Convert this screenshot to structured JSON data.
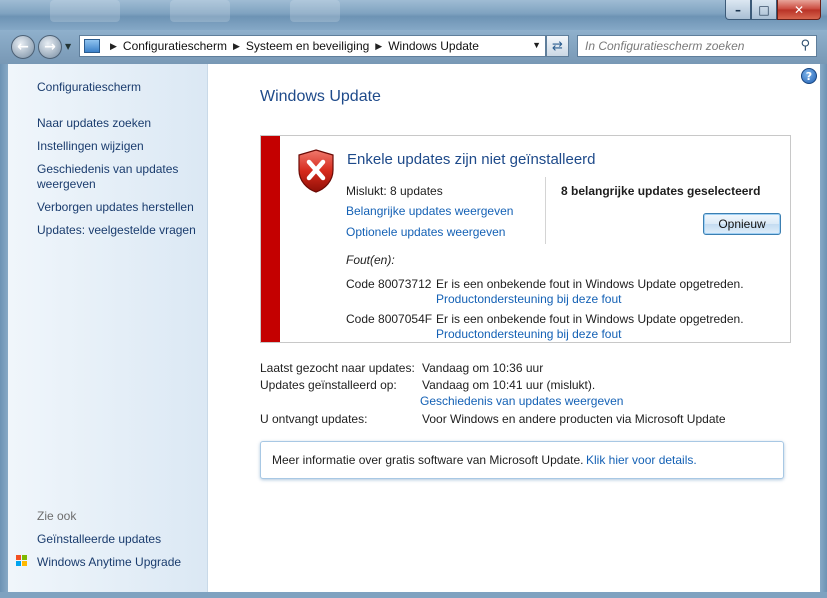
{
  "window": {
    "caption_buttons": {
      "minimize": "–",
      "maximize": "□",
      "close": "✕"
    }
  },
  "navbar": {
    "breadcrumbs": [
      "Configuratiescherm",
      "Systeem en beveiliging",
      "Windows Update"
    ],
    "search_placeholder": "In Configuratiescherm zoeken"
  },
  "sidebar": {
    "home": "Configuratiescherm",
    "links": [
      "Naar updates zoeken",
      "Instellingen wijzigen",
      "Geschiedenis van updates weergeven",
      "Verborgen updates herstellen",
      "Updates: veelgestelde vragen"
    ],
    "see_also_header": "Zie ook",
    "see_also": [
      "Geïnstalleerde updates",
      "Windows Anytime Upgrade"
    ]
  },
  "main": {
    "title": "Windows Update",
    "error_panel": {
      "heading": "Enkele updates zijn niet geïnstalleerd",
      "failed": "Mislukt: 8 updates",
      "link_important": "Belangrijke updates weergeven",
      "link_optional": "Optionele updates weergeven",
      "selected": "8 belangrijke updates geselecteerd",
      "retry_button": "Opnieuw",
      "errors_label": "Fout(en):",
      "errors": [
        {
          "code": "Code 80073712",
          "message": "Er is een onbekende fout in Windows Update opgetreden.",
          "link": "Productondersteuning bij deze fout"
        },
        {
          "code": "Code 8007054F",
          "message": "Er is een onbekende fout in Windows Update opgetreden.",
          "link": "Productondersteuning bij deze fout"
        }
      ]
    },
    "status": {
      "last_search_label": "Laatst gezocht naar updates:",
      "last_search_value": "Vandaag om 10:36 uur",
      "installed_label": "Updates geïnstalleerd op:",
      "installed_value": "Vandaag om 10:41 uur (mislukt).",
      "history_link": "Geschiedenis van updates weergeven",
      "receive_label": "U ontvangt updates:",
      "receive_value": "Voor Windows en andere producten via Microsoft Update"
    },
    "info": {
      "text": "Meer informatie over gratis software van Microsoft Update.",
      "link": "Klik hier voor details."
    }
  },
  "colors": {
    "error_bar": "#c40000",
    "link": "#1461b5",
    "title": "#1e4a8a"
  }
}
